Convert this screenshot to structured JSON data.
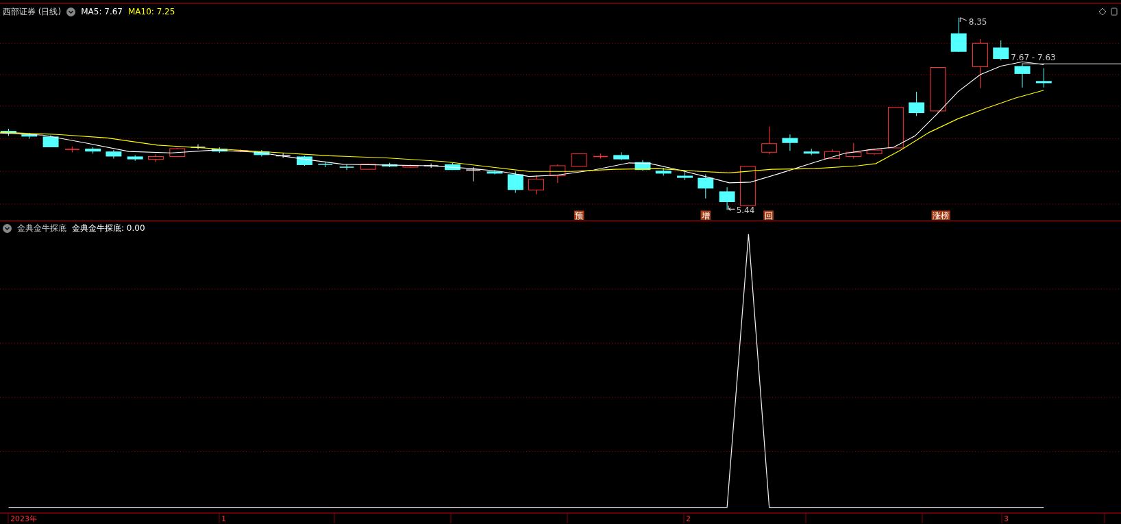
{
  "title": "西部证券",
  "period": "(日线)",
  "ma": [
    {
      "label": "MA5: 7.67",
      "color": "#ffffff"
    },
    {
      "label": "MA10: 7.25",
      "color": "#ffff00"
    }
  ],
  "price_labels": [
    {
      "text": "8.35"
    },
    {
      "text": "7.67 - 7.63"
    },
    {
      "text": "5.44"
    }
  ],
  "signal_tags": [
    "预",
    "增",
    "回",
    "涨榜"
  ],
  "indicator": {
    "name": "金典金牛探底",
    "reading": "金典金牛探底: 0.00"
  },
  "time_axis": [
    "2023年",
    "1",
    "2",
    "3"
  ]
}
